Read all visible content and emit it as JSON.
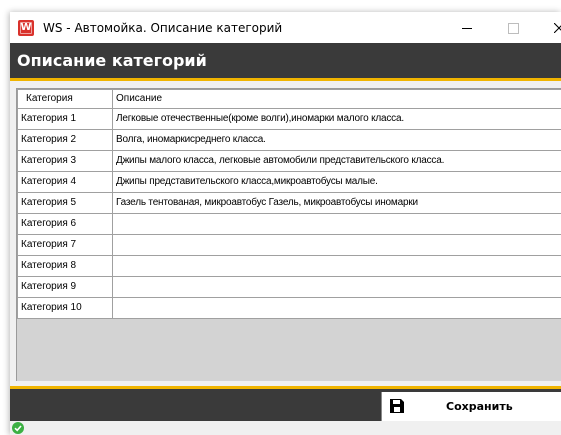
{
  "window": {
    "title": "WS - Автомойка. Описание категорий",
    "app_icon": "ws-app-icon",
    "app_icon_letter": "W",
    "controls": [
      "minimize-icon",
      "maximize-icon",
      "close-icon"
    ]
  },
  "header": {
    "title": "Описание категорий"
  },
  "colors": {
    "accent": "#f0b400",
    "dark_bar": "#3a3a3a",
    "status_ok": "#3cb043"
  },
  "table": {
    "columns": [
      "Категория",
      "Описание"
    ],
    "rows": [
      {
        "category": "Категория 1",
        "description": "Легковые отечественные(кроме волги),иномарки малого класса."
      },
      {
        "category": "Категория 2",
        "description": "Волга, иномаркисреднего класса."
      },
      {
        "category": "Категория 3",
        "description": "Джипы малого класса, легковые автомобили представительского класса."
      },
      {
        "category": "Категория 4",
        "description": "Джипы представительского класса,микроавтобусы  малые."
      },
      {
        "category": "Категория 5",
        "description": "Газель тентованая, микроавтобус Газель, микроавтобусы иномарки"
      },
      {
        "category": "Категория 6",
        "description": ""
      },
      {
        "category": "Категория 7",
        "description": ""
      },
      {
        "category": "Категория 8",
        "description": ""
      },
      {
        "category": "Категория 9",
        "description": ""
      },
      {
        "category": "Категория 10",
        "description": ""
      }
    ]
  },
  "footer": {
    "save_label": "Сохранить",
    "save_icon": "floppy-disk-icon"
  },
  "status": {
    "icon": "check-circle-icon"
  }
}
